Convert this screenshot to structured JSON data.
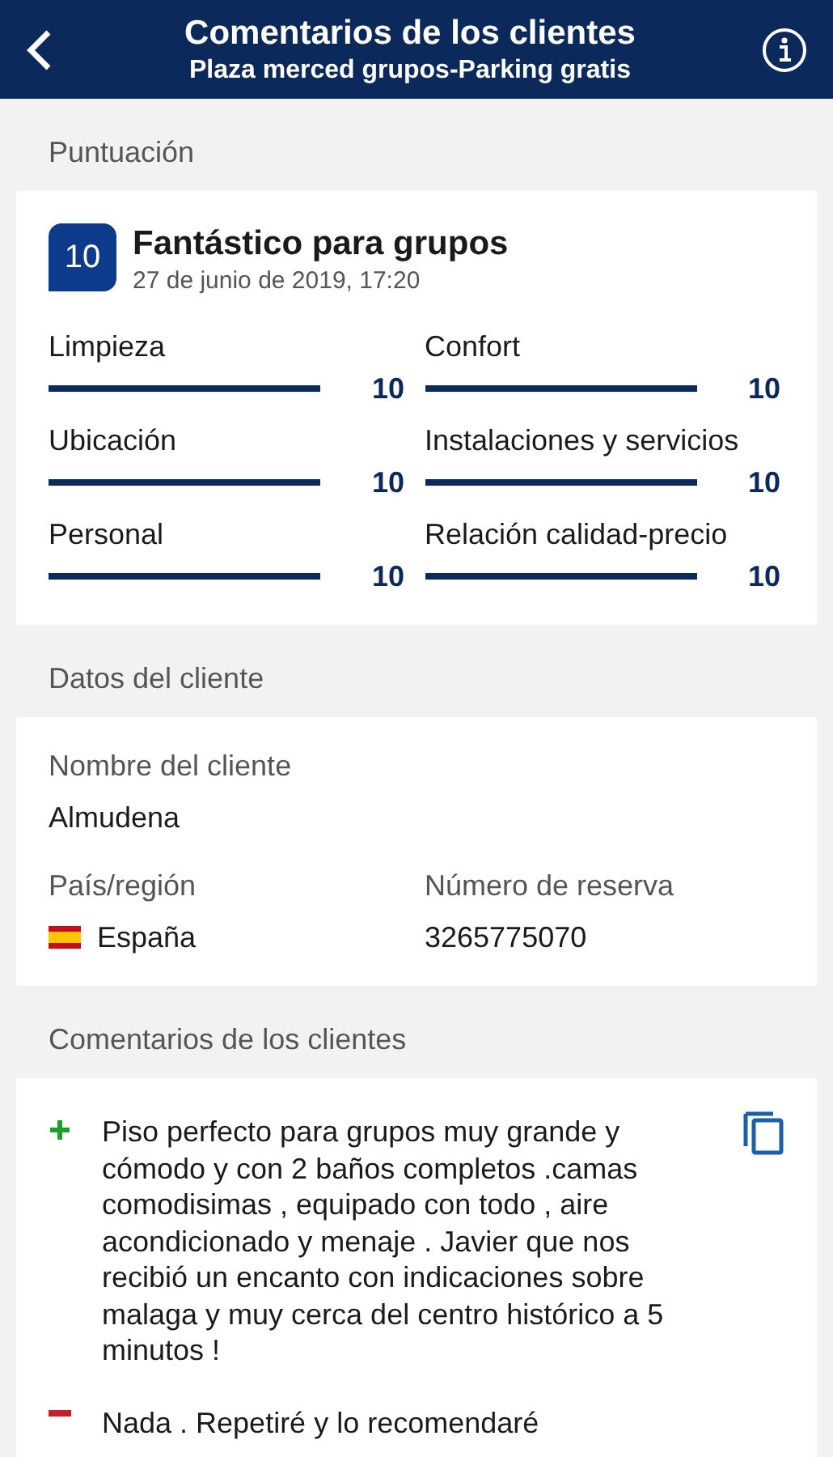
{
  "header": {
    "title": "Comentarios de los clientes",
    "subtitle": "Plaza merced grupos-Parking gratis"
  },
  "score_section": {
    "heading": "Puntuación",
    "badge": "10",
    "headline": "Fantástico para grupos",
    "date": "27 de junio de 2019, 17:20",
    "categories": [
      {
        "label": "Limpieza",
        "score": "10",
        "level": 1
      },
      {
        "label": "Confort",
        "score": "10",
        "level": 1
      },
      {
        "label": "Ubicación",
        "score": "10",
        "level": 1
      },
      {
        "label": "Instalaciones y servicios",
        "score": "10",
        "level": 1
      },
      {
        "label": "Personal",
        "score": "10",
        "level": 1
      },
      {
        "label": "Relación calidad-precio",
        "score": "10",
        "level": 1
      }
    ]
  },
  "guest_section": {
    "heading": "Datos del cliente",
    "name_label": "Nombre del cliente",
    "name": "Almudena",
    "country_label": "País/región",
    "country": "España",
    "booking_label": "Número de reserva",
    "booking": "3265775070"
  },
  "comments_section": {
    "heading": "Comentarios de los clientes",
    "comments": [
      {
        "kind": "positive",
        "text": "Piso perfecto para grupos muy grande y cómodo y con 2 baños completos .camas comodisimas , equipado con todo , aire acondicionado y menaje . Javier que nos recibió un encanto con indicaciones sobre malaga y muy cerca del centro histórico a 5 minutos !"
      },
      {
        "kind": "negative",
        "text": "Nada . Repetiré y lo recomendaré"
      }
    ]
  }
}
